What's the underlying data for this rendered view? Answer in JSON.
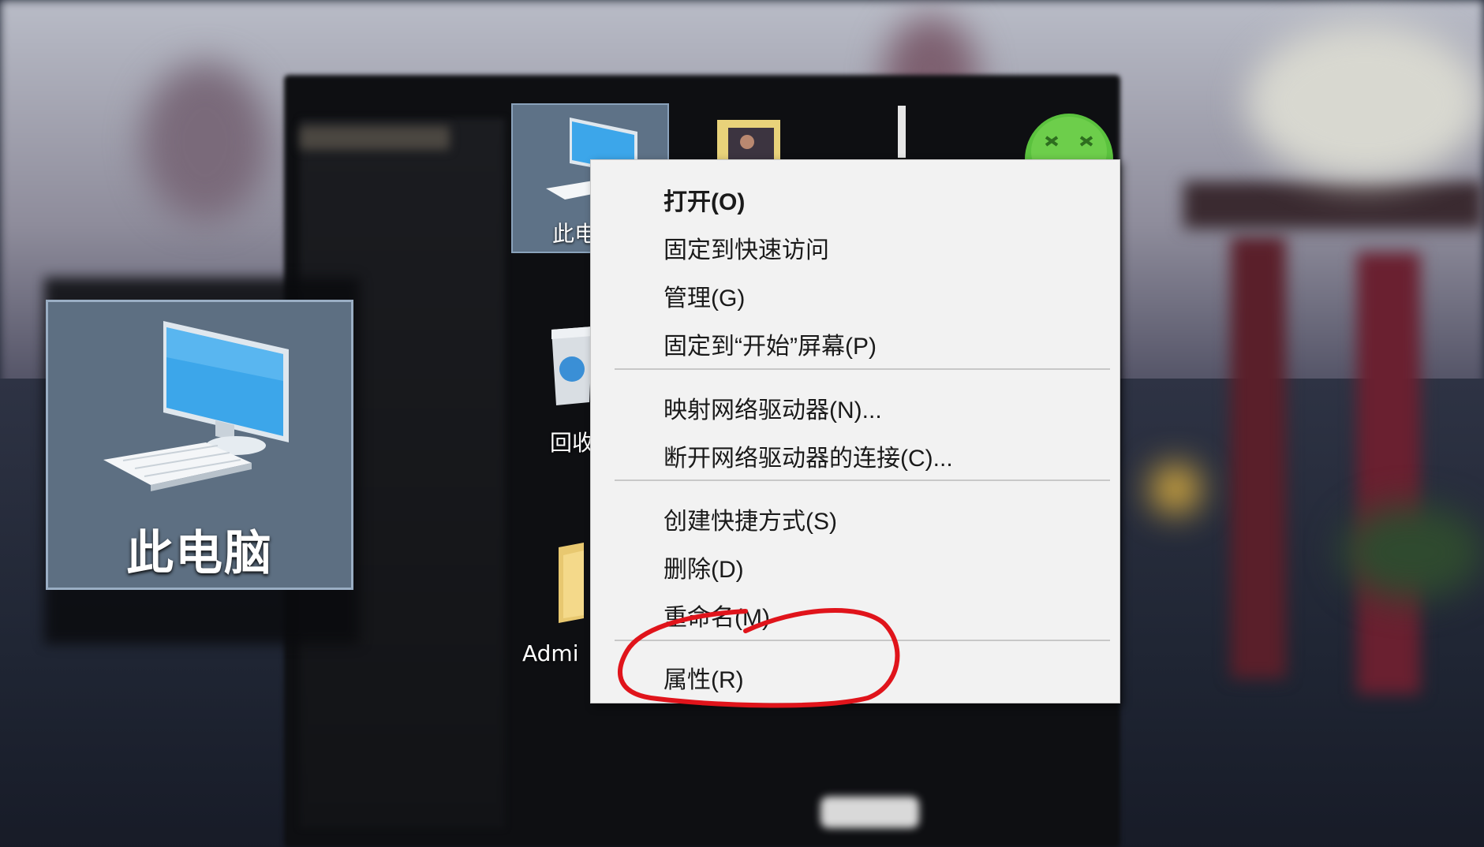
{
  "desktop": {
    "icons": [
      {
        "label": "此电",
        "icon": "this-pc-icon",
        "selected": true
      },
      {
        "label": "回收",
        "icon": "recycle-bin-icon"
      },
      {
        "label": "Admi",
        "icon": "user-folder-icon"
      },
      {
        "label": "",
        "icon": "photo-file-icon"
      },
      {
        "label": "",
        "icon": "green-app-icon"
      }
    ]
  },
  "zoom_callout": {
    "label": "此电脑",
    "icon": "this-pc-icon"
  },
  "context_menu": {
    "groups": [
      [
        {
          "label": "打开(O)",
          "default": true
        },
        {
          "label": "固定到快速访问"
        },
        {
          "label": "管理(G)"
        },
        {
          "label": "固定到“开始”屏幕(P)"
        }
      ],
      [
        {
          "label": "映射网络驱动器(N)..."
        },
        {
          "label": "断开网络驱动器的连接(C)..."
        }
      ],
      [
        {
          "label": "创建快捷方式(S)"
        },
        {
          "label": "删除(D)"
        },
        {
          "label": "重命名(M)"
        }
      ],
      [
        {
          "label": "属性(R)",
          "highlighted_by_annotation": true
        }
      ]
    ]
  },
  "annotation": {
    "shape": "hand-drawn ellipse",
    "target": "属性(R)",
    "color": "#e0141b"
  }
}
